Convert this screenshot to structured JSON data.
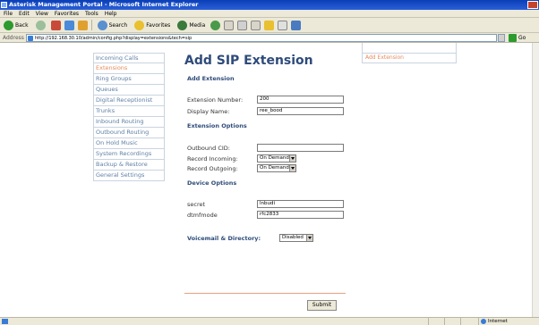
{
  "window": {
    "title": "Asterisk Management Portal - Microsoft Internet Explorer"
  },
  "menu": [
    "File",
    "Edit",
    "View",
    "Favorites",
    "Tools",
    "Help"
  ],
  "toolbar": {
    "back": "Back",
    "search": "Search",
    "favorites": "Favorites",
    "media": "Media"
  },
  "address": {
    "label": "Address",
    "url": "http://192.168.30.10/admin/config.php?display=extensions&tech=sip",
    "go": "Go"
  },
  "sidebar": {
    "items": [
      "Incoming Calls",
      "Extensions",
      "Ring Groups",
      "Queues",
      "Digital Receptionist",
      "Trunks",
      "Inbound Routing",
      "Outbound Routing",
      "On Hold Music",
      "System Recordings",
      "Backup & Restore",
      "General Settings"
    ],
    "active_index": 1
  },
  "right_panel": {
    "link": "Add Extension"
  },
  "form": {
    "title": "Add SIP Extension",
    "section_add": "Add Extension",
    "extension_number_label": "Extension Number:",
    "extension_number_value": "200",
    "display_name_label": "Display Name:",
    "display_name_value": "ree_bood",
    "section_options": "Extension Options",
    "outbound_cid_label": "Outbound CID:",
    "outbound_cid_value": "",
    "record_incoming_label": "Record Incoming:",
    "record_incoming_value": "On Demand",
    "record_outgoing_label": "Record Outgoing:",
    "record_outgoing_value": "On Demand",
    "section_device": "Device Options",
    "secret_label": "secret",
    "secret_value": "lnbudi",
    "dtmfmode_label": "dtmfmode",
    "dtmfmode_value": "rfc2833",
    "voicemail_label": "Voicemail & Directory:",
    "voicemail_value": "Disabled",
    "submit_label": "Submit"
  },
  "status": {
    "zone": "Internet"
  }
}
